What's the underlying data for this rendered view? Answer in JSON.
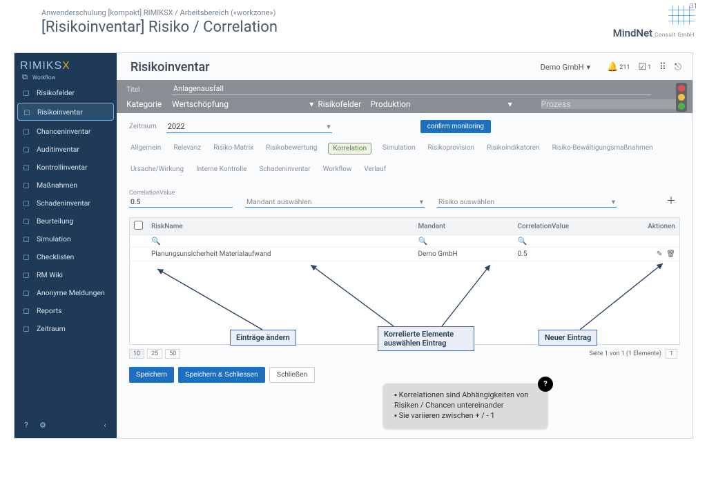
{
  "meta": {
    "page_number": "31",
    "super": "Anwenderschulung [kompakt] RIMIKSX / Arbeitsbereich («workzone»)",
    "title": "[Risikoinventar] Risiko / Correlation",
    "brand": "MindNet",
    "brand_sub": "Consult GmbH"
  },
  "logo": {
    "name": "RIMIKSX",
    "sub_label": "Workflow"
  },
  "sidebar": {
    "items": [
      {
        "label": "Risikofelder",
        "icon": "target-icon"
      },
      {
        "label": "Risikoinventar",
        "icon": "list-icon",
        "active": true
      },
      {
        "label": "Chanceninventar",
        "icon": "chance-icon"
      },
      {
        "label": "Auditinventar",
        "icon": "audit-icon"
      },
      {
        "label": "Kontrollinventar",
        "icon": "control-icon"
      },
      {
        "label": "Maßnahmen",
        "icon": "task-icon"
      },
      {
        "label": "Schadeninventar",
        "icon": "damage-icon"
      },
      {
        "label": "Beurteilung",
        "icon": "gauge-icon"
      },
      {
        "label": "Simulation",
        "icon": "sim-icon"
      },
      {
        "label": "Checklisten",
        "icon": "check-icon"
      },
      {
        "label": "RM Wiki",
        "icon": "wiki-icon"
      },
      {
        "label": "Anonyme Meldungen",
        "icon": "anon-icon"
      },
      {
        "label": "Reports",
        "icon": "report-icon"
      },
      {
        "label": "Zeitraum",
        "icon": "calendar-icon"
      }
    ]
  },
  "topbar": {
    "title": "Risikoinventar",
    "org": "Demo GmbH",
    "bell_count": "211",
    "tasks_count": "1"
  },
  "grey": {
    "title_label": "Titel",
    "title_value": "Anlagenausfall",
    "category_label": "Kategorie",
    "category_value": "Wertschöpfung",
    "rf_label": "Risikofelder",
    "rf_value": "Produktion",
    "process_placeholder": "Prozess"
  },
  "period": {
    "label": "Zeitraum",
    "value": "2022",
    "confirm": "confirm monitoring"
  },
  "tabs": [
    "Allgemein",
    "Relevanz",
    "Risiko-Matrix",
    "Risikobewertung",
    "Korrelation",
    "Simulation",
    "Risikoprovision",
    "Risikoindikatoren",
    "Risiko-Bewältigungsmaßnahmen",
    "Ursache/Wirkung",
    "Interne Kontrolle",
    "Schadeninventar",
    "Workflow",
    "Verlauf"
  ],
  "form": {
    "correlation_label": "CorrelationValue",
    "correlation_value": "0.5",
    "mandant_placeholder": "Mandant auswählen",
    "risiko_placeholder": "Risiko auswählen"
  },
  "table": {
    "headers": {
      "risk": "RiskName",
      "mandant": "Mandant",
      "corr": "CorrelationValue",
      "actions": "Aktionen"
    },
    "rows": [
      {
        "risk": "Planungsunsicherheit Materialaufwand",
        "mandant": "Demo GmbH",
        "corr": "0.5"
      }
    ]
  },
  "pager": {
    "sizes": [
      "10",
      "25",
      "50"
    ],
    "active": "10",
    "info": "Seite 1 von 1 (1 Elemente)",
    "page": "1"
  },
  "buttons": {
    "save": "Speichern",
    "save_close": "Speichern & Schliessen",
    "close": "Schließen"
  },
  "callouts": {
    "change": "Einträge ändern",
    "select": "Korrelierte Elemente auswählen Eintrag",
    "new": "Neuer Eintrag",
    "tip_line1": "Korrelationen sind Abhängigkeiten von Risiken / Chancen untereinander",
    "tip_line2": "Sie variieren zwischen + / - 1"
  }
}
